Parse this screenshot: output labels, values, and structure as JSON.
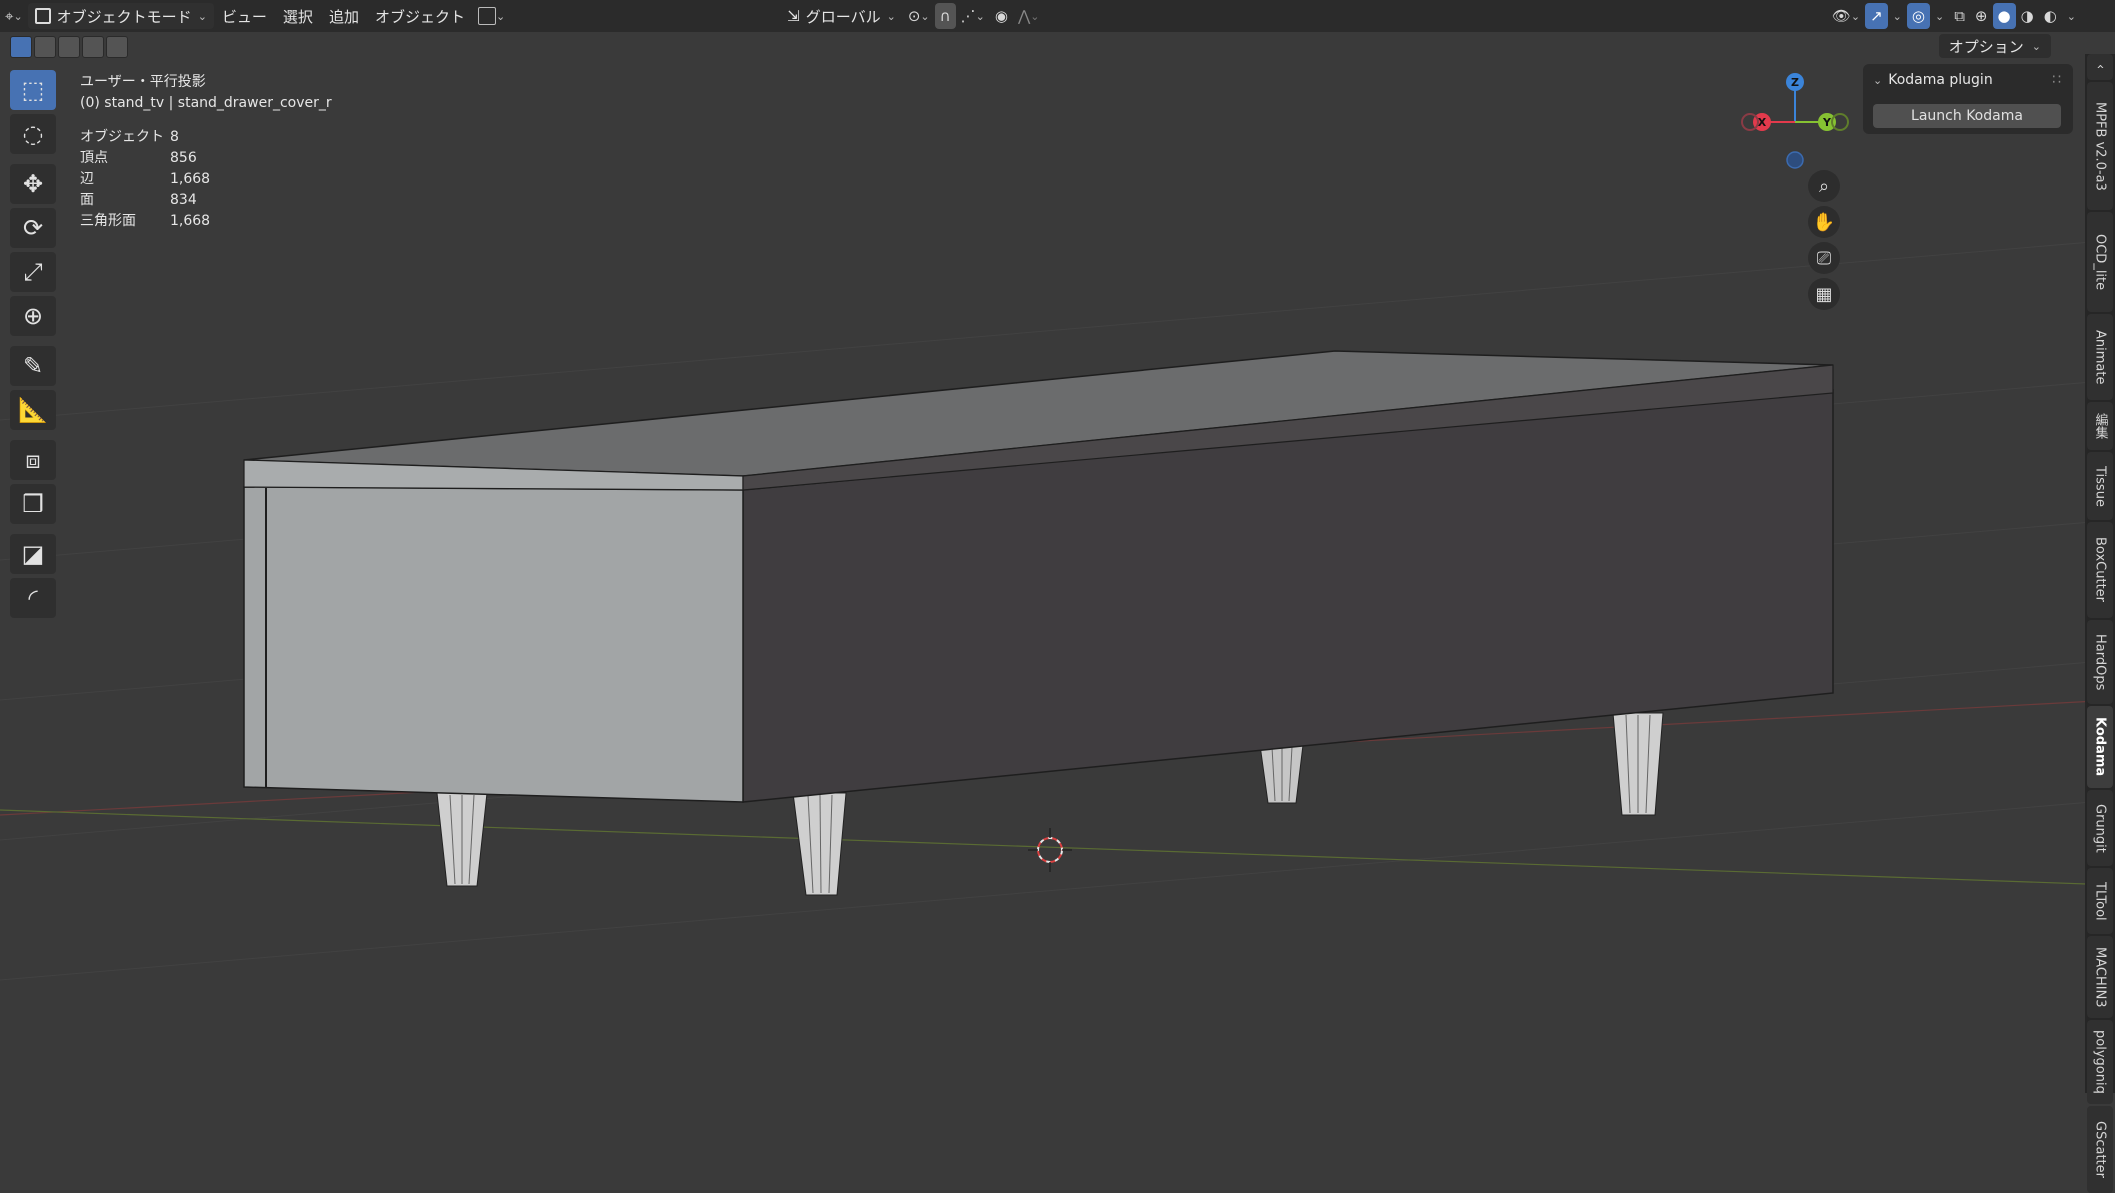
{
  "header": {
    "editor_icon": "view3d-icon",
    "mode": "オブジェクトモード",
    "menus": [
      "ビュー",
      "選択",
      "追加",
      "オブジェクト"
    ],
    "transform_orientation": "グローバル",
    "options_label": "オプション"
  },
  "viewport": {
    "view_name": "ユーザー・平行投影",
    "object_context": "(0) stand_tv | stand_drawer_cover_r",
    "stats": [
      {
        "label": "オブジェクト",
        "value": "8"
      },
      {
        "label": "頂点",
        "value": "856"
      },
      {
        "label": "辺",
        "value": "1,668"
      },
      {
        "label": "面",
        "value": "834"
      },
      {
        "label": "三角形面",
        "value": "1,668"
      }
    ],
    "gizmo_axes": {
      "x": "X",
      "y": "Y",
      "z": "Z"
    },
    "gizmo_colors": {
      "x": "#e33a4c",
      "y": "#86c232",
      "z": "#3b84d9"
    }
  },
  "tools": [
    {
      "name": "select-box-tool",
      "icon": "cursor-select-icon",
      "selected": true
    },
    {
      "name": "cursor-tool",
      "icon": "crosshair-cursor-icon"
    },
    {
      "name": "move-tool",
      "icon": "move-arrows-icon"
    },
    {
      "name": "rotate-tool",
      "icon": "rotate-icon"
    },
    {
      "name": "scale-tool",
      "icon": "scale-icon"
    },
    {
      "name": "transform-tool",
      "icon": "transform-icon"
    },
    {
      "name": "annotate-tool",
      "icon": "pencil-annotate-icon"
    },
    {
      "name": "measure-tool",
      "icon": "ruler-measure-icon"
    },
    {
      "name": "add-cube-tool",
      "icon": "add-cube-icon"
    },
    {
      "name": "tool-extra-1",
      "icon": "cube-transform-icon"
    },
    {
      "name": "tool-extra-2",
      "icon": "box-cut-icon"
    },
    {
      "name": "tool-extra-3",
      "icon": "bevel-icon"
    }
  ],
  "npanel": {
    "panel_title": "Kodama plugin",
    "launch_button": "Launch Kodama"
  },
  "sidebar_tabs": [
    "MPFB v2.0-a3",
    "OCD_lite",
    "Animate",
    "編集",
    "Tissue",
    "BoxCutter",
    "HardOps",
    "Kodama",
    "Grungit",
    "TLTool",
    "MACHIN3",
    "polygoniq",
    "GScatter"
  ],
  "active_tab": "Kodama",
  "colors": {
    "accent": "#4772b3",
    "viewport_bg": "#3a3a3a",
    "header_bg": "#2b2b2b"
  }
}
